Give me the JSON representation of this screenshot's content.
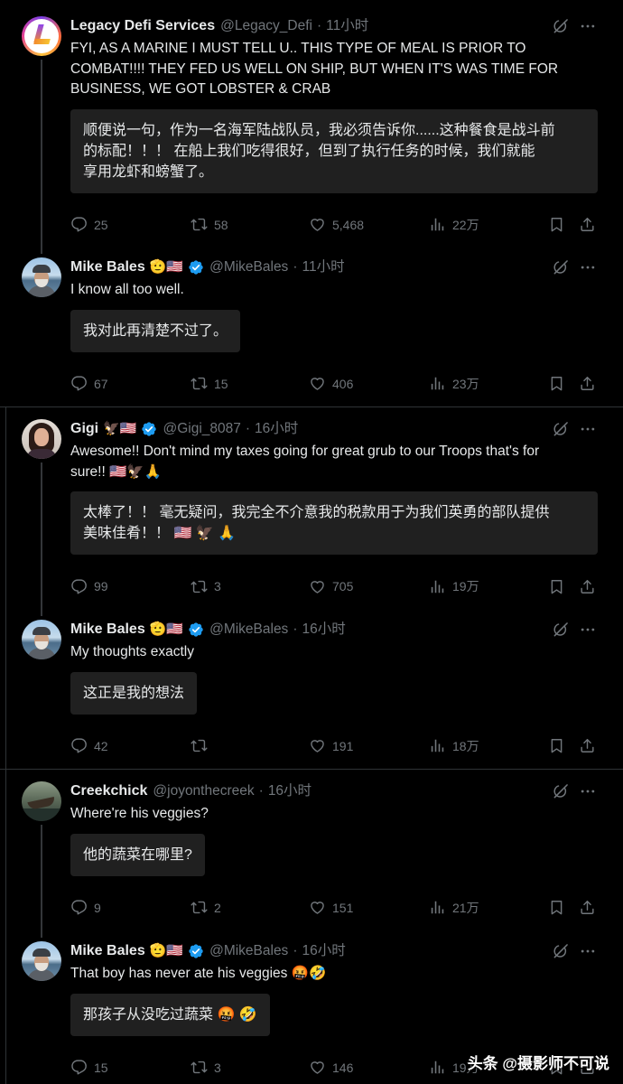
{
  "separator": "·",
  "colors": {
    "background": "#000000",
    "text": "#e7e9ea",
    "muted": "#71767b",
    "verified": "#1d9bf0",
    "translation_box": "#202020",
    "divider": "#2f3336"
  },
  "icons": {
    "reply": "reply-icon",
    "repost": "repost-icon",
    "like": "heart-icon",
    "views": "views-icon",
    "bookmark": "bookmark-icon",
    "share": "share-icon",
    "grok": "grok-icon",
    "more": "more-icon",
    "verified": "verified-badge-icon"
  },
  "posts": [
    {
      "name": "Legacy Defi Services",
      "verified": false,
      "handle": "@Legacy_Defi",
      "time": "11小时",
      "text": [
        "FYI, AS A MARINE I MUST TELL U.. THIS TYPE OF MEAL IS PRIOR TO",
        "COMBAT!!!! THEY FED US WELL ON SHIP, BUT WHEN IT'S WAS TIME FOR",
        "BUSINESS, WE GOT LOBSTER & CRAB"
      ],
      "translation": [
        "顺便说一句，作为一名海军陆战队员，我必须告诉你......这种餐食是战斗前",
        "的标配！！！ 在船上我们吃得很好，但到了执行任务的时候，我们就能",
        "享用龙虾和螃蟹了。"
      ],
      "stats": {
        "replies": "25",
        "reposts": "58",
        "likes": "5,468",
        "views": "22万"
      }
    },
    {
      "name": "Mike Bales",
      "badges": "🫡🇺🇸",
      "verified": true,
      "handle": "@MikeBales",
      "time": "11小时",
      "text": [
        "I know all too well."
      ],
      "translation": [
        "我对此再清楚不过了。"
      ],
      "stats": {
        "replies": "67",
        "reposts": "15",
        "likes": "406",
        "views": "23万"
      }
    },
    {
      "name": "Gigi",
      "badges": "🦅🇺🇸",
      "verified": true,
      "handle": "@Gigi_8087",
      "time": "16小时",
      "text": [
        "Awesome!! Don't mind my taxes going for great grub to our Troops that's for",
        "sure!! 🇺🇸🦅🙏"
      ],
      "translation": [
        "太棒了！！ 毫无疑问，我完全不介意我的税款用于为我们英勇的部队提供",
        "美味佳肴！！ 🇺🇸 🦅 🙏"
      ],
      "stats": {
        "replies": "99",
        "reposts": "3",
        "likes": "705",
        "views": "19万"
      }
    },
    {
      "name": "Mike Bales",
      "badges": "🫡🇺🇸",
      "verified": true,
      "handle": "@MikeBales",
      "time": "16小时",
      "text": [
        "My thoughts exactly"
      ],
      "translation": [
        "这正是我的想法"
      ],
      "stats": {
        "replies": "42",
        "likes": "191",
        "views": "18万"
      }
    },
    {
      "name": "Creekchick",
      "verified": false,
      "handle": "@joyonthecreek",
      "time": "16小时",
      "text": [
        "Where're his veggies?"
      ],
      "translation": [
        "他的蔬菜在哪里?"
      ],
      "stats": {
        "replies": "9",
        "reposts": "2",
        "likes": "151",
        "views": "21万"
      }
    },
    {
      "name": "Mike Bales",
      "badges": "🫡🇺🇸",
      "verified": true,
      "handle": "@MikeBales",
      "time": "16小时",
      "text": [
        "That boy has never ate his veggies 🤬🤣"
      ],
      "translation": [
        "那孩子从没吃过蔬菜 🤬 🤣"
      ],
      "stats": {
        "replies": "15",
        "reposts": "3",
        "likes": "146",
        "views": "19万"
      }
    }
  ],
  "watermark": "头条 @摄影师不可说"
}
